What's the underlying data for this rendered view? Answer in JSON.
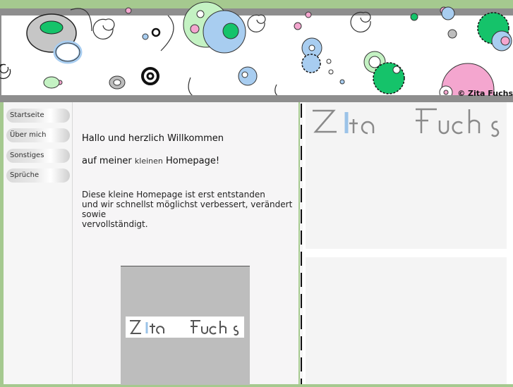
{
  "banner": {
    "copyright": "© Zita Fuchs",
    "logo_alt": "Zita Fuchs"
  },
  "sidebar": {
    "items": [
      {
        "label": "Startseite"
      },
      {
        "label": "Über mich"
      },
      {
        "label": "Sonstiges"
      },
      {
        "label": "Sprüche"
      }
    ]
  },
  "main": {
    "greeting": "Hallo und herzlich Willkommen",
    "sub_prefix": "auf meiner",
    "sub_small": "kleinen",
    "sub_suffix": "Homepage!",
    "intro_lines": [
      "Diese kleine Homepage ist erst entstanden",
      "und wir schnellst möglichst verbessert, verändert",
      "sowie",
      "vervollständigt."
    ]
  },
  "colors": {
    "background": "#a5c98f",
    "gray_band": "#8e8e8e",
    "logo_gray": "#8a8a8a",
    "logo_blue": "#9bc3e8",
    "accent_pink": "#f4a6cf",
    "accent_green": "#15c36a",
    "accent_blue": "#a8cdf0"
  }
}
